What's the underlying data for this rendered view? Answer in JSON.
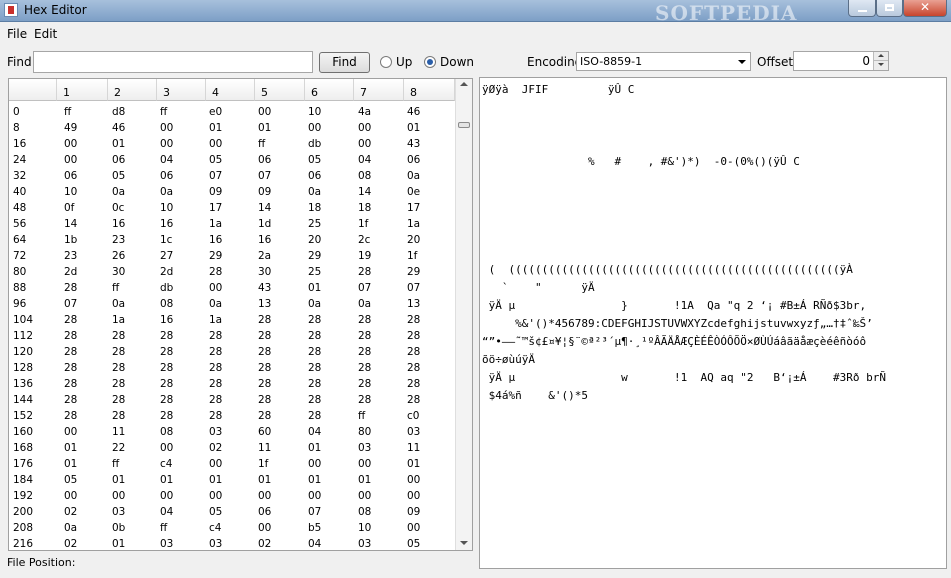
{
  "window": {
    "title": "Hex Editor",
    "watermark": "SOFTPEDIA"
  },
  "menu": [
    "File",
    "Edit"
  ],
  "toolbar": {
    "find_label": "Find",
    "find_value": "",
    "find_button": "Find",
    "up_label": "Up",
    "down_label": "Down",
    "direction_selected": "Down",
    "encoding_label": "Encoding",
    "encoding_value": "ISO-8859-1",
    "offset_label": "Offset",
    "offset_value": "0"
  },
  "hex_table": {
    "columns": [
      "1",
      "2",
      "3",
      "4",
      "5",
      "6",
      "7",
      "8"
    ],
    "rows": [
      {
        "offset": "0",
        "bytes": [
          "ff",
          "d8",
          "ff",
          "e0",
          "00",
          "10",
          "4a",
          "46"
        ]
      },
      {
        "offset": "8",
        "bytes": [
          "49",
          "46",
          "00",
          "01",
          "01",
          "00",
          "00",
          "01"
        ]
      },
      {
        "offset": "16",
        "bytes": [
          "00",
          "01",
          "00",
          "00",
          "ff",
          "db",
          "00",
          "43"
        ]
      },
      {
        "offset": "24",
        "bytes": [
          "00",
          "06",
          "04",
          "05",
          "06",
          "05",
          "04",
          "06"
        ]
      },
      {
        "offset": "32",
        "bytes": [
          "06",
          "05",
          "06",
          "07",
          "07",
          "06",
          "08",
          "0a"
        ]
      },
      {
        "offset": "40",
        "bytes": [
          "10",
          "0a",
          "0a",
          "09",
          "09",
          "0a",
          "14",
          "0e"
        ]
      },
      {
        "offset": "48",
        "bytes": [
          "0f",
          "0c",
          "10",
          "17",
          "14",
          "18",
          "18",
          "17"
        ]
      },
      {
        "offset": "56",
        "bytes": [
          "14",
          "16",
          "16",
          "1a",
          "1d",
          "25",
          "1f",
          "1a"
        ]
      },
      {
        "offset": "64",
        "bytes": [
          "1b",
          "23",
          "1c",
          "16",
          "16",
          "20",
          "2c",
          "20"
        ]
      },
      {
        "offset": "72",
        "bytes": [
          "23",
          "26",
          "27",
          "29",
          "2a",
          "29",
          "19",
          "1f"
        ]
      },
      {
        "offset": "80",
        "bytes": [
          "2d",
          "30",
          "2d",
          "28",
          "30",
          "25",
          "28",
          "29"
        ]
      },
      {
        "offset": "88",
        "bytes": [
          "28",
          "ff",
          "db",
          "00",
          "43",
          "01",
          "07",
          "07"
        ]
      },
      {
        "offset": "96",
        "bytes": [
          "07",
          "0a",
          "08",
          "0a",
          "13",
          "0a",
          "0a",
          "13"
        ]
      },
      {
        "offset": "104",
        "bytes": [
          "28",
          "1a",
          "16",
          "1a",
          "28",
          "28",
          "28",
          "28"
        ]
      },
      {
        "offset": "112",
        "bytes": [
          "28",
          "28",
          "28",
          "28",
          "28",
          "28",
          "28",
          "28"
        ]
      },
      {
        "offset": "120",
        "bytes": [
          "28",
          "28",
          "28",
          "28",
          "28",
          "28",
          "28",
          "28"
        ]
      },
      {
        "offset": "128",
        "bytes": [
          "28",
          "28",
          "28",
          "28",
          "28",
          "28",
          "28",
          "28"
        ]
      },
      {
        "offset": "136",
        "bytes": [
          "28",
          "28",
          "28",
          "28",
          "28",
          "28",
          "28",
          "28"
        ]
      },
      {
        "offset": "144",
        "bytes": [
          "28",
          "28",
          "28",
          "28",
          "28",
          "28",
          "28",
          "28"
        ]
      },
      {
        "offset": "152",
        "bytes": [
          "28",
          "28",
          "28",
          "28",
          "28",
          "28",
          "ff",
          "c0"
        ]
      },
      {
        "offset": "160",
        "bytes": [
          "00",
          "11",
          "08",
          "03",
          "60",
          "04",
          "80",
          "03"
        ]
      },
      {
        "offset": "168",
        "bytes": [
          "01",
          "22",
          "00",
          "02",
          "11",
          "01",
          "03",
          "11"
        ]
      },
      {
        "offset": "176",
        "bytes": [
          "01",
          "ff",
          "c4",
          "00",
          "1f",
          "00",
          "00",
          "01"
        ]
      },
      {
        "offset": "184",
        "bytes": [
          "05",
          "01",
          "01",
          "01",
          "01",
          "01",
          "01",
          "00"
        ]
      },
      {
        "offset": "192",
        "bytes": [
          "00",
          "00",
          "00",
          "00",
          "00",
          "00",
          "00",
          "00"
        ]
      },
      {
        "offset": "200",
        "bytes": [
          "02",
          "03",
          "04",
          "05",
          "06",
          "07",
          "08",
          "09"
        ]
      },
      {
        "offset": "208",
        "bytes": [
          "0a",
          "0b",
          "ff",
          "c4",
          "00",
          "b5",
          "10",
          "00"
        ]
      },
      {
        "offset": "216",
        "bytes": [
          "02",
          "01",
          "03",
          "03",
          "02",
          "04",
          "03",
          "05"
        ]
      }
    ]
  },
  "text_view": [
    "ÿØÿà  JFIF         ÿÛ C",
    "",
    "",
    "",
    "                %   #    , #&')*)  -0-(0%()(ÿÛ C",
    "",
    "",
    "",
    "",
    "",
    " (  ((((((((((((((((((((((((((((((((((((((((((((((((((ÿÀ",
    "   `    \"      ÿÄ",
    " ÿÄ µ                }       !1A  Qa \"q 2 ‘¡ #B±Á RÑð$3br‚",
    "     %&'()*456789:CDEFGHIJSTUVWXYZcdefghijstuvwxyzƒ„…†‡ˆ‰Š’",
    "“”•–—˜™š¢£¤¥¦§¨©ª²³´µ¶·¸¹ºÂÃÄÅÆÇÈÉÊÒÓÔÕÖ×ØÙÚáâãäåæçèéêñòóô",
    "õö÷øùúÿÄ",
    " ÿÄ µ                w       !1  AQ aq \"2   B‘¡±Á    #3Rð brÑ",
    " $4á%ñ    &'()*5"
  ],
  "status": {
    "file_position_label": "File Position:",
    "file_position_value": ""
  }
}
